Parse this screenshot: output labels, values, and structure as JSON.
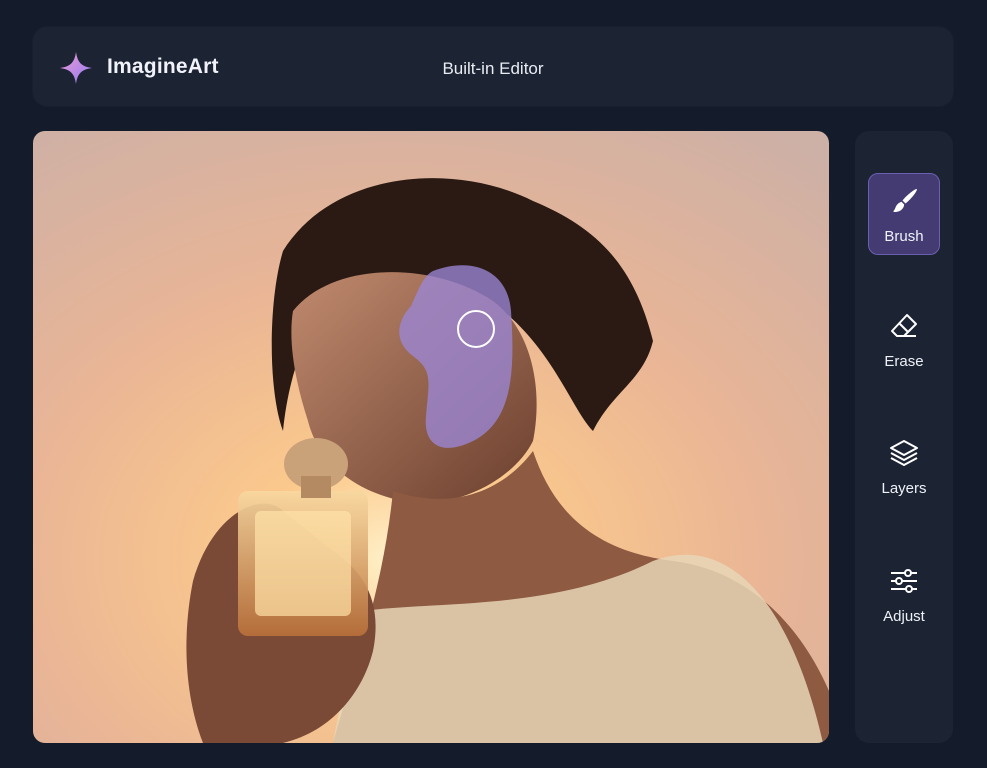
{
  "header": {
    "brand": "ImagineArt",
    "title": "Built-in Editor",
    "logo_icon": "sparkle-star-icon"
  },
  "canvas": {
    "image_description_icon": "photo-woman-perfume-sunset",
    "mask_color": "#9b86d6"
  },
  "tools": [
    {
      "label": "Brush",
      "icon": "paintbrush-icon",
      "active": true
    },
    {
      "label": "Erase",
      "icon": "eraser-icon",
      "active": false
    },
    {
      "label": "Layers",
      "icon": "layers-icon",
      "active": false
    },
    {
      "label": "Adjust",
      "icon": "sliders-icon",
      "active": false
    }
  ],
  "colors": {
    "background": "#141b2b",
    "panel": "#1c2333",
    "accent": "#433b72"
  }
}
